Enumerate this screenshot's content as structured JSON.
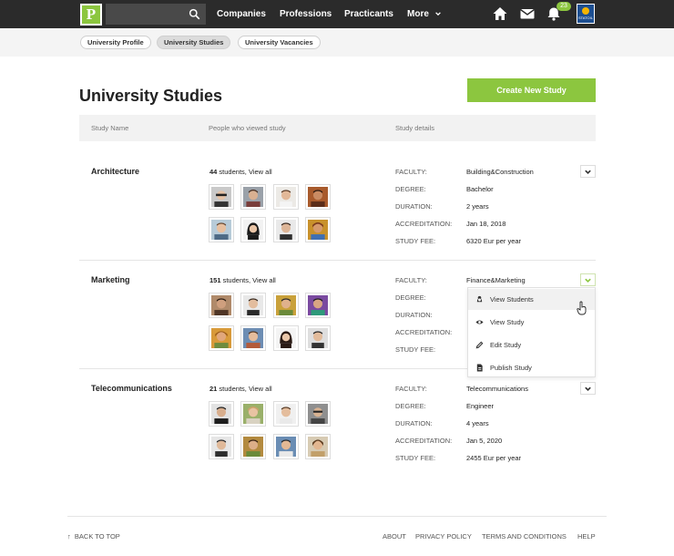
{
  "topbar": {
    "logo": "P",
    "nav": [
      "Companies",
      "Professions",
      "Practicants",
      "More"
    ],
    "notification_count": "23",
    "avatar_label": "STATOIL",
    "icons": [
      "search-icon",
      "home-icon",
      "mail-icon",
      "bell-icon",
      "chevron-down-icon"
    ]
  },
  "subnav": [
    "University Profile",
    "University Studies",
    "University Vacancies"
  ],
  "page": {
    "title": "University Studies",
    "create_button": "Create New Study"
  },
  "table": {
    "headers": [
      "Study Name",
      "People who viewed study",
      "Study details"
    ]
  },
  "studies": [
    {
      "name": "Architecture",
      "viewers_count": "44",
      "viewers_suffix": " students, ",
      "view_all": "View all",
      "details": [
        {
          "label": "FACULTY:",
          "value": "Building&Construction"
        },
        {
          "label": "DEGREE:",
          "value": "Bachelor"
        },
        {
          "label": "DURATION:",
          "value": "2 years"
        },
        {
          "label": "ACCREDITATION:",
          "value": "Jan 18, 2018"
        },
        {
          "label": "STUDY FEE:",
          "value": "6320 Eur per year"
        }
      ]
    },
    {
      "name": "Marketing",
      "viewers_count": "151",
      "viewers_suffix": " students, ",
      "view_all": "View all",
      "details": [
        {
          "label": "FACULTY:",
          "value": "Finance&Marketing"
        },
        {
          "label": "DEGREE:",
          "value": ""
        },
        {
          "label": "DURATION:",
          "value": ""
        },
        {
          "label": "ACCREDITATION:",
          "value": ""
        },
        {
          "label": "STUDY FEE:",
          "value": ""
        }
      ]
    },
    {
      "name": "Telecommunications",
      "viewers_count": "21",
      "viewers_suffix": " students, ",
      "view_all": "View all",
      "details": [
        {
          "label": "FACULTY:",
          "value": "Telecommunications"
        },
        {
          "label": "DEGREE:",
          "value": "Engineer"
        },
        {
          "label": "DURATION:",
          "value": "4 years"
        },
        {
          "label": "ACCREDITATION:",
          "value": "Jan 5, 2020"
        },
        {
          "label": "STUDY FEE:",
          "value": "2455 Eur per year"
        }
      ]
    }
  ],
  "menu": [
    {
      "label": "View Students",
      "icon": "student-icon"
    },
    {
      "label": "View Study",
      "icon": "eye-icon"
    },
    {
      "label": "Edit Study",
      "icon": "pencil-icon"
    },
    {
      "label": "Publish Study",
      "icon": "document-icon"
    }
  ],
  "footer": {
    "back_to_top": "BACK TO TOP",
    "links": [
      "ABOUT",
      "PRIVACY POLICY",
      "TERMS AND CONDITIONS",
      "HELP"
    ]
  },
  "colors": {
    "brand_green": "#8cc63f",
    "topbar_bg": "#2b2b2b"
  }
}
